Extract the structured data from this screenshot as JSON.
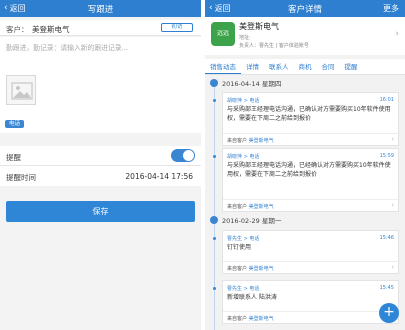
{
  "left": {
    "back_label": "返回",
    "title": "写跟进",
    "customer_label": "客户：",
    "customer_name": "美登斯电气",
    "stage": "初访",
    "content_placeholder": "勤跟进，勤记录：请输入新的跟进记录...",
    "tag": "电话",
    "remind_label": "提醒",
    "remind_on": true,
    "remind_time_label": "提醒时间",
    "remind_time_value": "2016-04-14  17:56",
    "save_label": "保存"
  },
  "right": {
    "back_label": "返回",
    "title": "客户详情",
    "more_label": "更多",
    "customer": {
      "avatar_text": "远远",
      "name": "美登斯电气",
      "address": "地址:",
      "owner": "负责人：曹先生  |  客户体验账号"
    },
    "tabs": [
      "销售动态",
      "详情",
      "联系人",
      "商机",
      "合同",
      "提醒"
    ],
    "groups": [
      {
        "date": "2016-04-14  星期四",
        "entries": [
          {
            "meta": "胡晓萍 > 电话",
            "time": "16:01",
            "text": "与采购部王经理电话沟通，已确认对方需要购买10年软件使用权，需要在下周二之前给到报价",
            "from_label": "来自客户",
            "from_link": "美登斯电气"
          },
          {
            "meta": "胡晓萍 > 电话",
            "time": "15:59",
            "text": "与采购部王经理电话沟通，已经确认对方需要购买10年软件使用权，需要在下周二之前给到报价",
            "from_label": "来自客户",
            "from_link": "美登斯电气"
          }
        ]
      },
      {
        "date": "2016-02-29  星期一",
        "entries": [
          {
            "meta": "曹先生 > 电话",
            "time": "15:46",
            "text": "钉钉使用",
            "from_label": "来自客户",
            "from_link": "美登斯电气"
          },
          {
            "meta": "曹先生 > 电话",
            "time": "15:45",
            "text": "新增联系人 陆洪涛",
            "from_label": "来自客户",
            "from_link": "美登斯电气"
          }
        ]
      }
    ],
    "fab_label": "+"
  },
  "colors": {
    "nav": "#2f7fd0",
    "accent": "#3a86d3",
    "avatar": "#3da34a"
  }
}
